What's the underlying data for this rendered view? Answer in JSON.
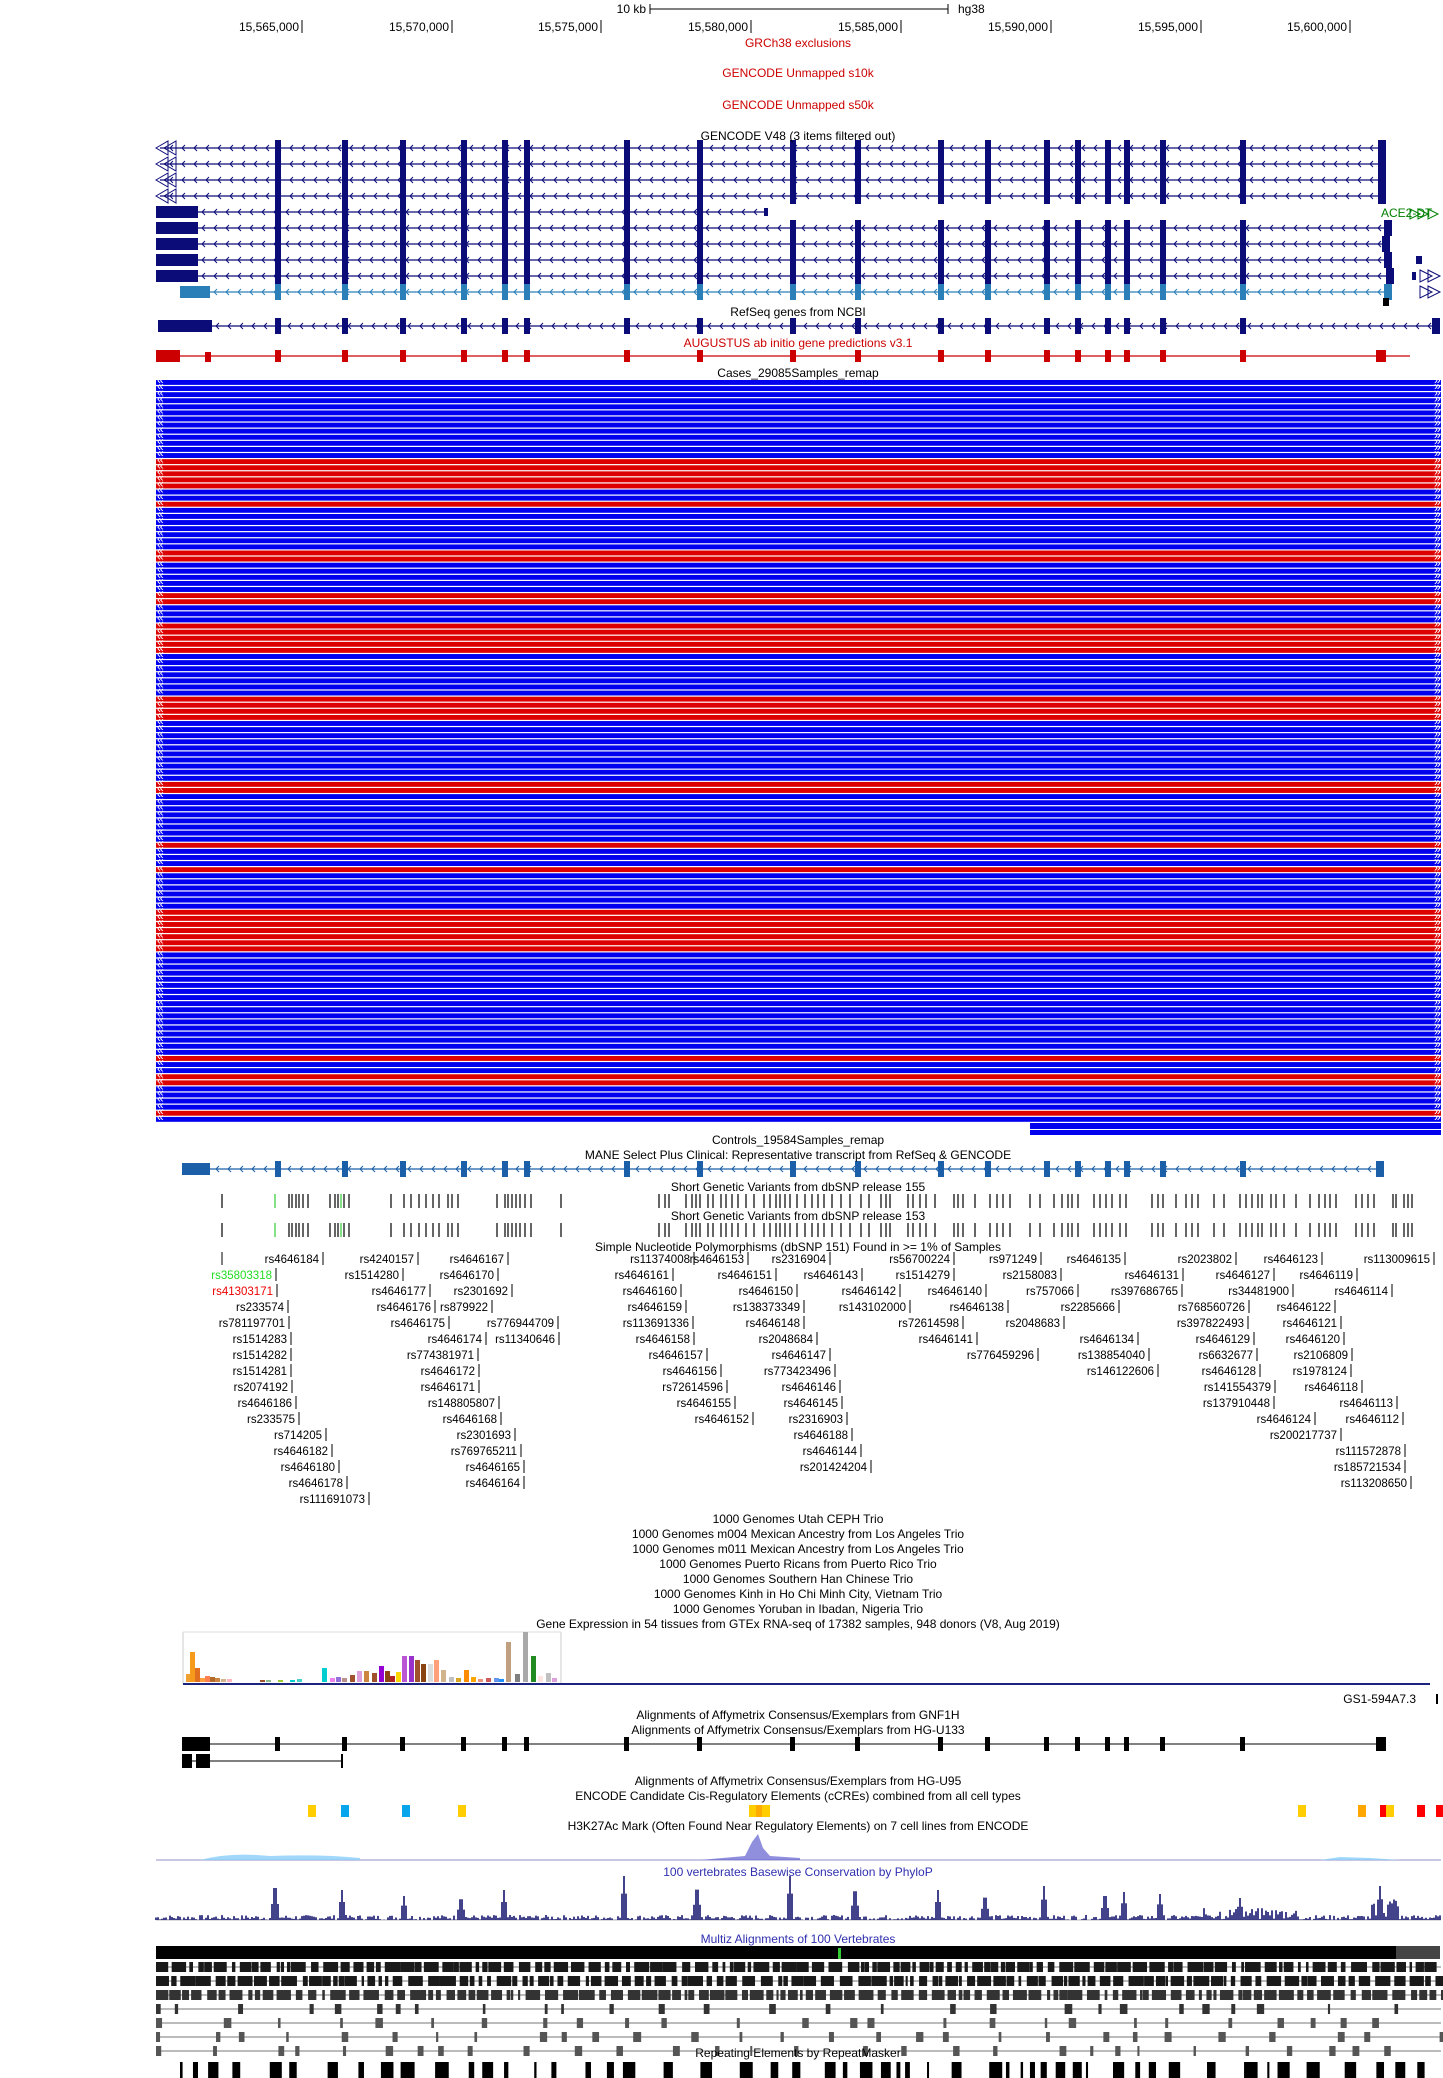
{
  "ruler": {
    "scale_label": "10 kb",
    "assembly": "hg38",
    "positions": [
      "15,565,000",
      "15,570,000",
      "15,575,000",
      "15,580,000",
      "15,585,000",
      "15,590,000",
      "15,595,000",
      "15,600,000"
    ]
  },
  "colors": {
    "blue_track": "#0000ee",
    "red_track": "#dd0000",
    "gene_navy": "#0c0c78",
    "gene_red": "#cc0000",
    "green": "#008000",
    "cons_navy": "#14146e",
    "ruler_text": "#000000",
    "exclusion_red": "#cc0000"
  },
  "tracks": {
    "grch38_exclusions": "GRCh38 exclusions",
    "unmapped_10k": "GENCODE Unmapped s10k",
    "unmapped_50k": "GENCODE Unmapped s50k",
    "gencode": "GENCODE V48 (3 items filtered out)",
    "ace2_label": "ACE2-DT",
    "refseq": "RefSeq genes from NCBI",
    "augustus": "AUGUSTUS ab initio gene predictions v3.1",
    "cases": "Cases_29085Samples_remap",
    "controls": "Controls_19584Samples_remap",
    "mane": "MANE Select Plus Clinical: Representative transcript from RefSeq & GENCODE",
    "dbsnp155": "Short Genetic Variants from dbSNP release 155",
    "dbsnp153": "Short Genetic Variants from dbSNP release 153",
    "common_snps": "Simple Nucleotide Polymorphisms (dbSNP 151) Found in >= 1% of Samples",
    "tg_ceph": "1000 Genomes Utah CEPH Trio",
    "tg_m004": "1000 Genomes m004 Mexican Ancestry from Los Angeles Trio",
    "tg_m011": "1000 Genomes m011 Mexican Ancestry from Los Angeles Trio",
    "tg_pr": "1000 Genomes Puerto Ricans from Puerto Rico Trio",
    "tg_han": "1000 Genomes Southern Han Chinese Trio",
    "tg_kinh": "1000 Genomes Kinh in Ho Chi Minh City, Vietnam Trio",
    "tg_yri": "1000 Genomes Yoruban in Ibadan, Nigeria Trio",
    "gtex": "Gene Expression in 54 tissues from GTEx RNA-seq of 17382 samples, 948 donors (V8, Aug 2019)",
    "gtex_gene": "GS1-594A7.3",
    "affy_gnf1h": "Alignments of Affymetrix Consensus/Exemplars from GNF1H",
    "affy_u133": "Alignments of Affymetrix Consensus/Exemplars from HG-U133",
    "affy_u95": "Alignments of Affymetrix Consensus/Exemplars from HG-U95",
    "encode_ccre": "ENCODE Candidate Cis-Regulatory Elements (cCREs) combined from all cell types",
    "h3k27ac": "H3K27Ac Mark (Often Found Near Regulatory Elements) on 7 cell lines from ENCODE",
    "phylop": "100 vertebrates Basewise Conservation by PhyloP",
    "multiz": "Multiz Alignments of 100 Vertebrates",
    "repeatmasker": "Repeating Elements by RepeatMasker"
  },
  "snp_labels": [
    {
      "id": "rs4646184",
      "col": "l"
    },
    {
      "id": "rs4240157",
      "col": "l"
    },
    {
      "id": "rs4646167",
      "col": "l"
    },
    {
      "id": "rs11374008",
      "col": "l"
    },
    {
      "id": "rs4646153",
      "col": "l"
    },
    {
      "id": "rs2316904",
      "col": "l"
    },
    {
      "id": "rs56700224",
      "col": "l"
    },
    {
      "id": "rs971249",
      "col": "l"
    },
    {
      "id": "rs4646135",
      "col": "l"
    },
    {
      "id": "rs2023802",
      "col": "l"
    },
    {
      "id": "rs4646123",
      "col": "l"
    },
    {
      "id": "rs113009615",
      "col": "l"
    },
    {
      "id": "rs35803318",
      "col": "green"
    },
    {
      "id": "rs1514280",
      "col": "l"
    },
    {
      "id": "rs4646170",
      "col": "l"
    },
    {
      "id": "rs4646161",
      "col": "l"
    },
    {
      "id": "rs4646151",
      "col": "l"
    },
    {
      "id": "rs4646143",
      "col": "l"
    },
    {
      "id": "rs1514279",
      "col": "l"
    },
    {
      "id": "rs2158083",
      "col": "l"
    },
    {
      "id": "rs4646131",
      "col": "l"
    },
    {
      "id": "rs4646127",
      "col": "l"
    },
    {
      "id": "rs4646119",
      "col": "l"
    },
    {
      "id": "rs41303171",
      "col": "red"
    },
    {
      "id": "rs4646177",
      "col": "l"
    },
    {
      "id": "rs2301692",
      "col": "l"
    },
    {
      "id": "rs4646160",
      "col": "l"
    },
    {
      "id": "rs4646150",
      "col": "l"
    },
    {
      "id": "rs4646142",
      "col": "l"
    },
    {
      "id": "rs4646140",
      "col": "l"
    },
    {
      "id": "rs757066",
      "col": "l"
    },
    {
      "id": "rs397686765",
      "col": "l"
    },
    {
      "id": "rs34481900",
      "col": "l"
    },
    {
      "id": "rs4646114",
      "col": "l"
    },
    {
      "id": "rs233574",
      "col": "l"
    },
    {
      "id": "rs4646176",
      "col": "l"
    },
    {
      "id": "rs879922",
      "col": "l"
    },
    {
      "id": "rs4646159",
      "col": "l"
    },
    {
      "id": "rs138373349",
      "col": "l"
    },
    {
      "id": "rs143102000",
      "col": "l"
    },
    {
      "id": "rs4646138",
      "col": "l"
    },
    {
      "id": "rs2285666",
      "col": "l"
    },
    {
      "id": "rs768560726",
      "col": "l"
    },
    {
      "id": "rs4646122",
      "col": "l"
    },
    {
      "id": "rs781197701",
      "col": "l"
    },
    {
      "id": "rs4646175",
      "col": "l"
    },
    {
      "id": "rs776944709",
      "col": "l"
    },
    {
      "id": "rs113691336",
      "col": "l"
    },
    {
      "id": "rs4646148",
      "col": "l"
    },
    {
      "id": "rs72614598",
      "col": "l"
    },
    {
      "id": "rs2048683",
      "col": "l"
    },
    {
      "id": "rs397822493",
      "col": "l"
    },
    {
      "id": "rs4646121",
      "col": "l"
    },
    {
      "id": "rs1514283",
      "col": "l"
    },
    {
      "id": "rs4646174",
      "col": "l"
    },
    {
      "id": "rs11340646",
      "col": "l"
    },
    {
      "id": "rs4646158",
      "col": "l"
    },
    {
      "id": "rs2048684",
      "col": "l"
    },
    {
      "id": "rs4646141",
      "col": "l"
    },
    {
      "id": "rs4646134",
      "col": "l"
    },
    {
      "id": "rs4646129",
      "col": "l"
    },
    {
      "id": "rs4646120",
      "col": "l"
    },
    {
      "id": "rs1514282",
      "col": "l"
    },
    {
      "id": "rs774381971",
      "col": "l"
    },
    {
      "id": "rs4646157",
      "col": "l"
    },
    {
      "id": "rs4646147",
      "col": "l"
    },
    {
      "id": "rs776459296",
      "col": "l"
    },
    {
      "id": "rs138854040",
      "col": "l"
    },
    {
      "id": "rs6632677",
      "col": "l"
    },
    {
      "id": "rs2106809",
      "col": "l"
    },
    {
      "id": "rs1514281",
      "col": "l"
    },
    {
      "id": "rs4646172",
      "col": "l"
    },
    {
      "id": "rs4646156",
      "col": "l"
    },
    {
      "id": "rs773423496",
      "col": "l"
    },
    {
      "id": "rs146122606",
      "col": "l"
    },
    {
      "id": "rs4646128",
      "col": "l"
    },
    {
      "id": "rs1978124",
      "col": "l"
    },
    {
      "id": "rs2074192",
      "col": "l"
    },
    {
      "id": "rs4646171",
      "col": "l"
    },
    {
      "id": "rs72614596",
      "col": "l"
    },
    {
      "id": "rs4646146",
      "col": "l"
    },
    {
      "id": "rs141554379",
      "col": "l"
    },
    {
      "id": "rs4646118",
      "col": "l"
    },
    {
      "id": "rs4646186",
      "col": "l"
    },
    {
      "id": "rs148805807",
      "col": "l"
    },
    {
      "id": "rs4646155",
      "col": "l"
    },
    {
      "id": "rs4646145",
      "col": "l"
    },
    {
      "id": "rs137910448",
      "col": "l"
    },
    {
      "id": "rs4646113",
      "col": "l"
    },
    {
      "id": "rs233575",
      "col": "l"
    },
    {
      "id": "rs4646168",
      "col": "l"
    },
    {
      "id": "rs4646152",
      "col": "l"
    },
    {
      "id": "rs2316903",
      "col": "l"
    },
    {
      "id": "rs4646124",
      "col": "l"
    },
    {
      "id": "rs4646112",
      "col": "l"
    },
    {
      "id": "rs714205",
      "col": "l"
    },
    {
      "id": "rs2301693",
      "col": "l"
    },
    {
      "id": "rs4646188",
      "col": "l"
    },
    {
      "id": "rs200217737",
      "col": "l"
    },
    {
      "id": "rs4646182",
      "col": "l"
    },
    {
      "id": "rs769765211",
      "col": "l"
    },
    {
      "id": "rs4646144",
      "col": "l"
    },
    {
      "id": "rs111572878",
      "col": "l"
    },
    {
      "id": "rs4646180",
      "col": "l"
    },
    {
      "id": "rs4646165",
      "col": "l"
    },
    {
      "id": "rs201424204",
      "col": "l"
    },
    {
      "id": "rs185721534",
      "col": "l"
    },
    {
      "id": "rs4646178",
      "col": "l"
    },
    {
      "id": "rs4646164",
      "col": "l"
    },
    {
      "id": "rs113208650",
      "col": "l"
    },
    {
      "id": "rs111691073",
      "col": "l"
    }
  ],
  "cases_row_colors": "bbbbbbbbbbbbbrrrrrbbrbbbbbbbrrbbbbbrrbbbrrrrrbbbbbbbrrrrbbbbbbbbbbrrbbbbbbbbrbbbrbbbbbbrrrrrrrbbbbbbbbbbbbbbbbbrbbrrbbbbrb"
}
